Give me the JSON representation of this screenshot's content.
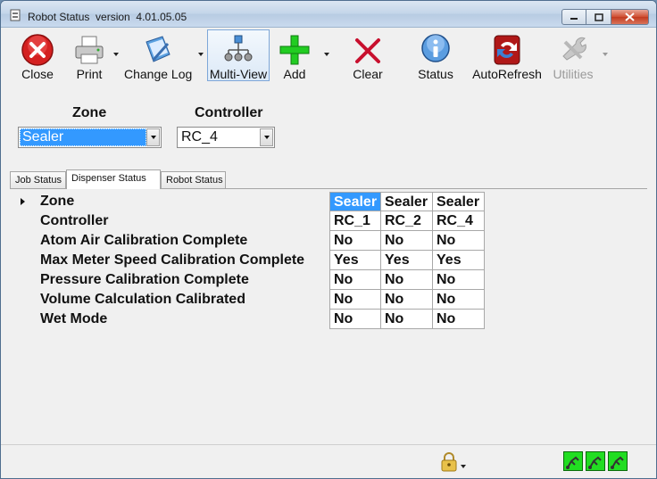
{
  "window": {
    "title": "Robot Status  version  4.01.05.05"
  },
  "toolbar": {
    "buttons": [
      {
        "label": "Close",
        "icon": "close-icon"
      },
      {
        "label": "Print",
        "icon": "printer-icon"
      },
      {
        "label": "Change Log",
        "icon": "logbook-icon"
      },
      {
        "label": "Multi-View",
        "icon": "network-icon"
      },
      {
        "label": "Add",
        "icon": "plus-icon"
      },
      {
        "label": "Clear",
        "icon": "x-mark-icon"
      },
      {
        "label": "Status",
        "icon": "info-icon"
      },
      {
        "label": "AutoRefresh",
        "icon": "refresh-icon"
      },
      {
        "label": "Utilities",
        "icon": "wrench-icon"
      }
    ]
  },
  "selectors": {
    "zone_label": "Zone",
    "zone_value": "Sealer",
    "controller_label": "Controller",
    "controller_value": "RC_4"
  },
  "tabs": [
    {
      "label": "Job Status"
    },
    {
      "label": "Dispenser Status"
    },
    {
      "label": "Robot Status"
    }
  ],
  "active_tab": "Dispenser Status",
  "grid": {
    "rows": [
      {
        "label": "Zone",
        "values": [
          "Sealer",
          "Sealer",
          "Sealer"
        ]
      },
      {
        "label": "Controller",
        "values": [
          "RC_1",
          "RC_2",
          "RC_4"
        ]
      },
      {
        "label": "Atom Air Calibration Complete",
        "values": [
          "No",
          "No",
          "No"
        ]
      },
      {
        "label": "Max Meter Speed Calibration Complete",
        "values": [
          "Yes",
          "Yes",
          "Yes"
        ]
      },
      {
        "label": "Pressure Calibration Complete",
        "values": [
          "No",
          "No",
          "No"
        ]
      },
      {
        "label": "Volume Calculation Calibrated",
        "values": [
          "No",
          "No",
          "No"
        ]
      },
      {
        "label": "Wet Mode",
        "values": [
          "No",
          "No",
          "No"
        ]
      }
    ]
  },
  "statusbar": {
    "lock_icon": "padlock-icon",
    "robot_indicators": 3
  },
  "colors": {
    "selection": "#3399ff",
    "indicator": "#22dd22"
  }
}
